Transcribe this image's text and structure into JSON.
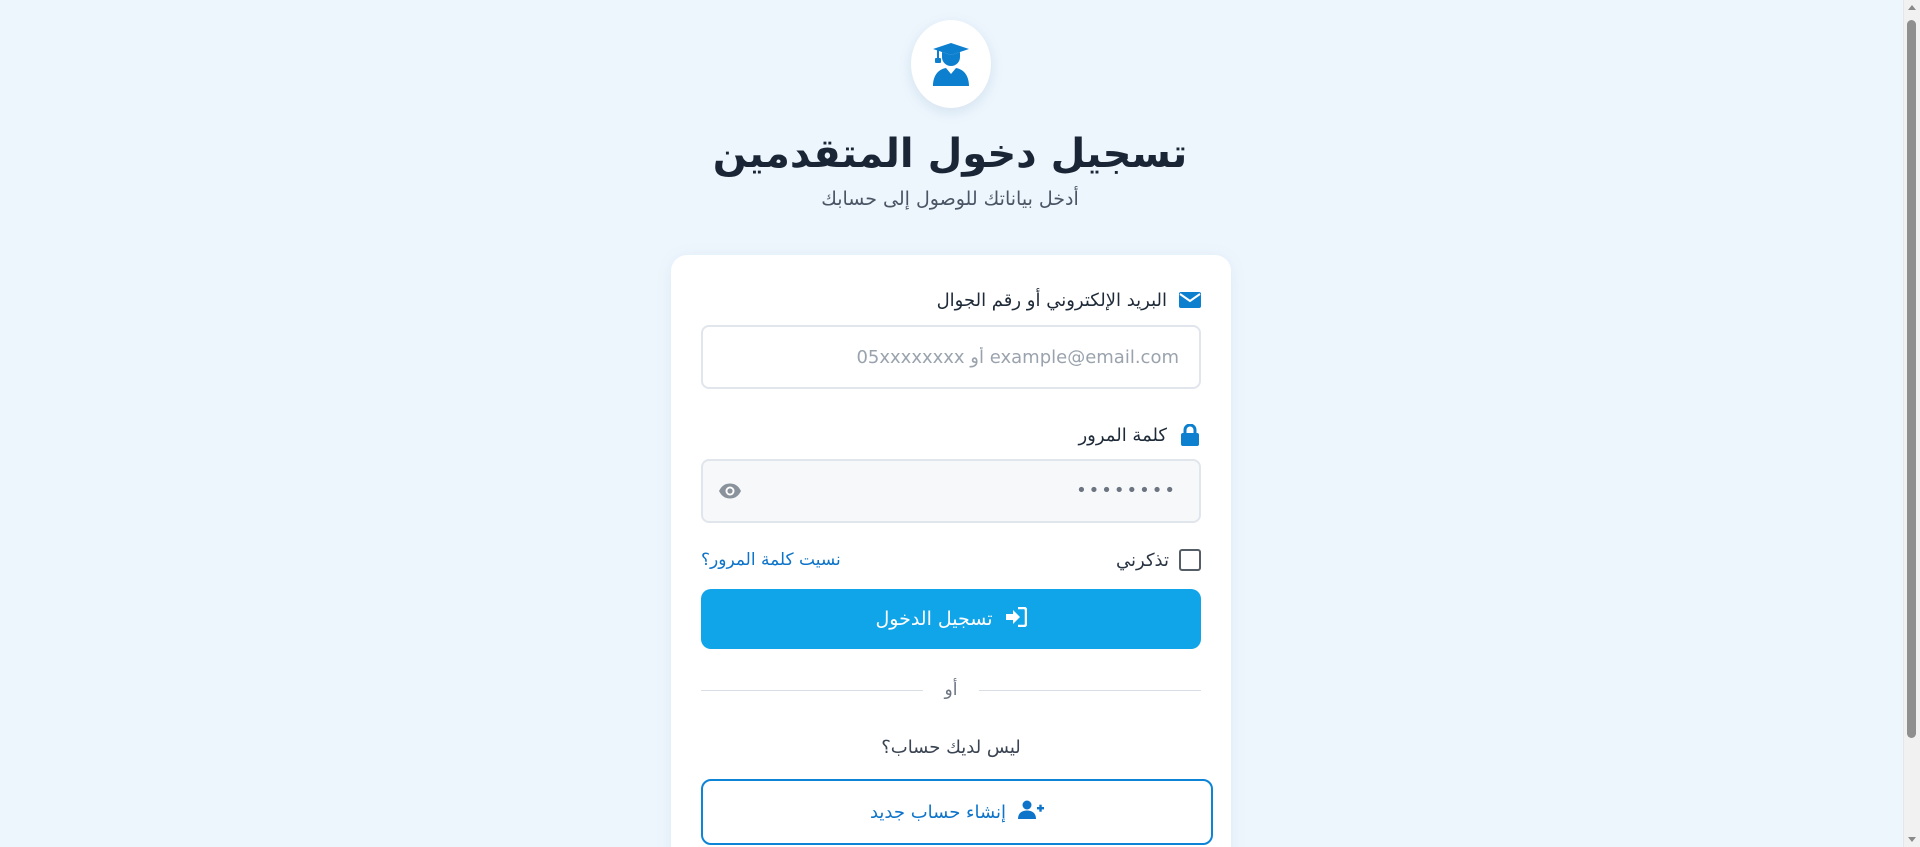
{
  "header": {
    "logo_icon": "graduate-student-icon",
    "title": "تسجيل دخول المتقدمين",
    "subtitle": "أدخل بياناتك للوصول إلى حسابك"
  },
  "form": {
    "email": {
      "label": "البريد الإلكتروني أو رقم الجوال",
      "icon": "envelope-icon",
      "placeholder": "example@email.com أو 05xxxxxxxx",
      "value": ""
    },
    "password": {
      "label": "كلمة المرور",
      "icon": "lock-icon",
      "masked_value": "••••••••",
      "toggle_icon": "eye-icon"
    },
    "remember_me": {
      "label": "تذكرني",
      "checked": false
    },
    "forgot_password": "نسيت كلمة المرور؟",
    "submit": {
      "label": "تسجيل الدخول",
      "icon": "sign-in-icon"
    },
    "divider_text": "أو",
    "no_account_text": "ليس لديك حساب؟",
    "register": {
      "label": "إنشاء حساب جديد",
      "icon": "user-plus-icon"
    }
  },
  "colors": {
    "background": "#eef6fd",
    "primary": "#10a4e8",
    "accent": "#0d74c9",
    "title": "#1a2535"
  }
}
